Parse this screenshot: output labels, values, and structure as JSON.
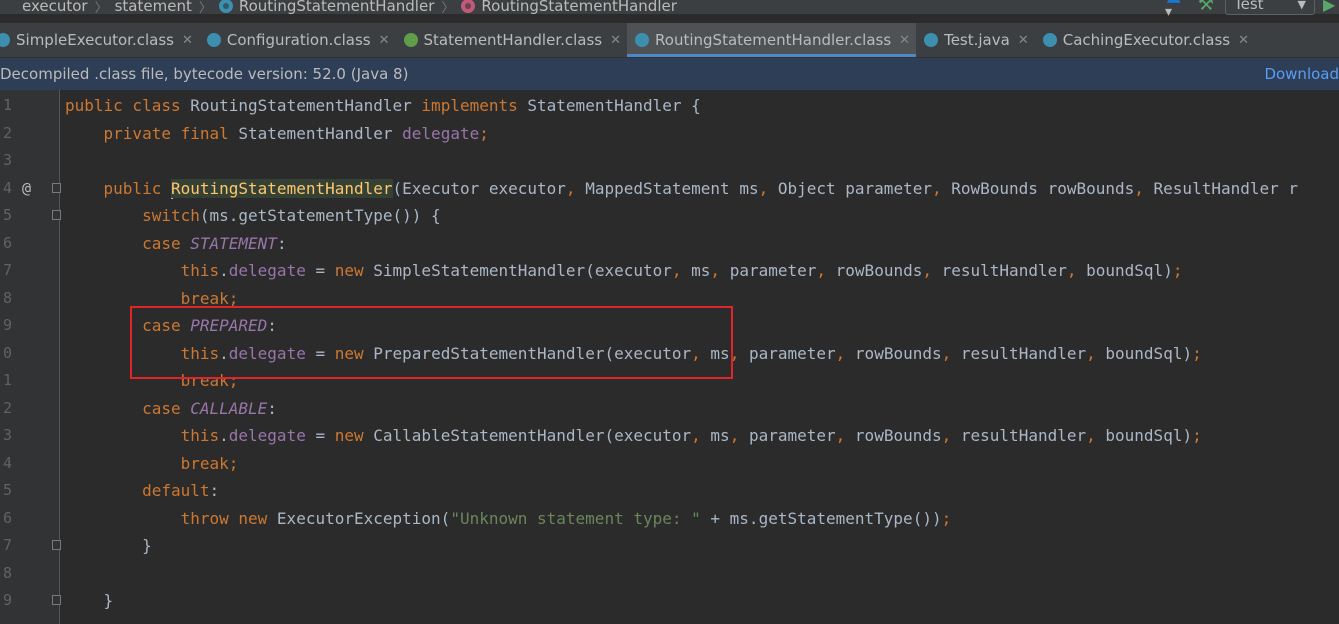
{
  "breadcrumb": {
    "items": [
      {
        "label": "executor",
        "icon": "none"
      },
      {
        "label": "statement",
        "icon": "none"
      },
      {
        "label": "RoutingStatementHandler",
        "icon": "class-icon"
      },
      {
        "label": "RoutingStatementHandler",
        "icon": "method-icon"
      }
    ],
    "run_config": "Test"
  },
  "tabs": [
    {
      "label": "SimpleExecutor.class",
      "icon": "class-icon",
      "active": false
    },
    {
      "label": "Configuration.class",
      "icon": "class-icon",
      "active": false
    },
    {
      "label": "StatementHandler.class",
      "icon": "interface-icon",
      "active": false
    },
    {
      "label": "RoutingStatementHandler.class",
      "icon": "class-icon",
      "active": true
    },
    {
      "label": "Test.java",
      "icon": "class-icon",
      "active": false
    },
    {
      "label": "CachingExecutor.class",
      "icon": "class-icon",
      "active": false
    }
  ],
  "notice": {
    "text": "Decompiled .class file, bytecode version: 52.0 (Java 8)",
    "link": "Download"
  },
  "editor": {
    "line_numbers": [
      "1",
      "2",
      "3",
      "4",
      "5",
      "6",
      "7",
      "8",
      "9",
      "0",
      "1",
      "2",
      "3",
      "4",
      "5",
      "6",
      "7",
      "8",
      "9"
    ],
    "annotation_mark": "@",
    "code": {
      "l1": [
        "public class ",
        "RoutingStatementHandler ",
        "implements ",
        "StatementHandler {"
      ],
      "l2": [
        "private final ",
        "StatementHandler ",
        "delegate",
        ";"
      ],
      "l4": [
        "public ",
        "RoutingStatementHandler",
        "(Executor executor",
        ", ",
        "MappedStatement ms",
        ", ",
        "Object parameter",
        ", ",
        "RowBounds rowBounds",
        ", ",
        "ResultHandler r"
      ],
      "l5": [
        "switch",
        "(ms.getStatementType()) {"
      ],
      "l6": [
        "case ",
        "STATEMENT",
        ":"
      ],
      "l7": [
        "this",
        ".",
        "delegate",
        " = ",
        "new ",
        "SimpleStatementHandler(executor",
        ", ",
        "ms",
        ", ",
        "parameter",
        ", ",
        "rowBounds",
        ", ",
        "resultHandler",
        ", ",
        "boundSql)",
        ";"
      ],
      "l8": [
        "break",
        ";"
      ],
      "l9": [
        "case ",
        "PREPARED",
        ":"
      ],
      "l10": [
        "this",
        ".",
        "delegate",
        " = ",
        "new ",
        "PreparedStatementHandler(executor",
        ", ",
        "ms",
        ", ",
        "parameter",
        ", ",
        "rowBounds",
        ", ",
        "resultHandler",
        ", ",
        "boundSql)",
        ";"
      ],
      "l11": [
        "break",
        ";"
      ],
      "l12": [
        "case ",
        "CALLABLE",
        ":"
      ],
      "l13": [
        "this",
        ".",
        "delegate",
        " = ",
        "new ",
        "CallableStatementHandler(executor",
        ", ",
        "ms",
        ", ",
        "parameter",
        ", ",
        "rowBounds",
        ", ",
        "resultHandler",
        ", ",
        "boundSql)",
        ";"
      ],
      "l14": [
        "break",
        ";"
      ],
      "l15": [
        "default",
        ":"
      ],
      "l16": [
        "throw ",
        "new ",
        "ExecutorException(",
        "\"Unknown statement type: \"",
        " + ms.getStatementType())",
        ";"
      ],
      "l17": [
        "}"
      ],
      "l19": [
        "}"
      ]
    }
  },
  "colors": {
    "keyword": "#cc7832",
    "field": "#9876aa",
    "string": "#6a8759",
    "text": "#a9b7c6",
    "highlight_box": "#e0242a",
    "tab_underline": "#4a88c7"
  }
}
